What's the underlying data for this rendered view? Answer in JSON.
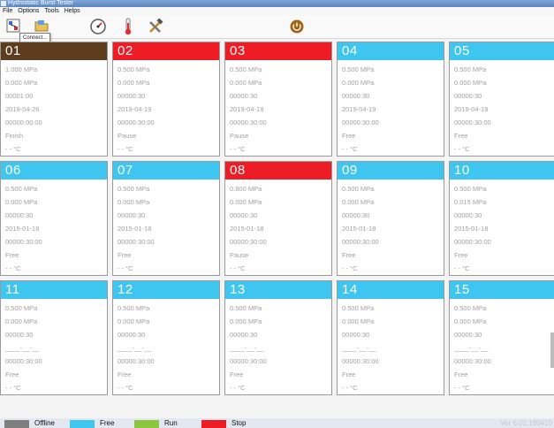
{
  "window": {
    "title": "Hydrostatic Burst Tester"
  },
  "menu": [
    "File",
    "Options",
    "Tools",
    "Helps"
  ],
  "toolbar": {
    "tooltip": "Connect...",
    "icons": [
      "connect-icon",
      "open-folder-icon",
      "pressure-gauge-icon",
      "thermometer-icon",
      "tools-icon",
      "power-icon"
    ]
  },
  "colors": {
    "offline": "#7f7f7f",
    "free": "#3ec6f0",
    "run": "#8cc63f",
    "stop": "#ee1c24",
    "finish": "#5e3c1e"
  },
  "cards": [
    {
      "id": "01",
      "status": "finish",
      "values": [
        "1.000 MPa",
        "0.000 MPa",
        "00001:00",
        "2019-04-26",
        "00000:00:00",
        "Finish",
        "- - °C"
      ]
    },
    {
      "id": "02",
      "status": "stop",
      "values": [
        "0.500 MPa",
        "0.000 MPa",
        "00000:30",
        "2019-04-19",
        "00000:30:00",
        "Pause",
        "- - °C"
      ]
    },
    {
      "id": "03",
      "status": "stop",
      "values": [
        "0.500 MPa",
        "0.000 MPa",
        "00000:30",
        "2019-04-19",
        "00000:30:00",
        "Pause",
        "- - °C"
      ]
    },
    {
      "id": "04",
      "status": "free",
      "values": [
        "0.500 MPa",
        "0.000 MPa",
        "00000:30",
        "2019-04-19",
        "00000:30:00",
        "Free",
        "- - °C"
      ]
    },
    {
      "id": "05",
      "status": "free",
      "values": [
        "0.500 MPa",
        "0.000 MPa",
        "00000:30",
        "2019-04-19",
        "00000:30:00",
        "Free",
        "- - °C"
      ]
    },
    {
      "id": "06",
      "status": "free",
      "values": [
        "0.500 MPa",
        "0.000 MPa",
        "00000:30",
        "2015-01-18",
        "00000:30:00",
        "Free",
        "- - °C"
      ]
    },
    {
      "id": "07",
      "status": "free",
      "values": [
        "0.500 MPa",
        "0.000 MPa",
        "00000:30",
        "2015-01-18",
        "00000:30:00",
        "Free",
        "- - °C"
      ]
    },
    {
      "id": "08",
      "status": "stop",
      "values": [
        "0.800 MPa",
        "0.000 MPa",
        "00000:30",
        "2015-01-18",
        "00000:30:00",
        "Pause",
        "- - °C"
      ]
    },
    {
      "id": "09",
      "status": "free",
      "values": [
        "0.500 MPa",
        "0.000 MPa",
        "00000:30",
        "2015-01-18",
        "00000:30:00",
        "Free",
        "- - °C"
      ]
    },
    {
      "id": "10",
      "status": "free",
      "values": [
        "0.500 MPa",
        "0.015 MPa",
        "00000:30",
        "2015-01-18",
        "00000:30:00",
        "Free",
        "- - °C"
      ]
    },
    {
      "id": "11",
      "status": "free",
      "values": [
        "0.500 MPa",
        "0.000 MPa",
        "00000:30",
        "____-__-__",
        "00000:30:00",
        "Free",
        "- - °C"
      ]
    },
    {
      "id": "12",
      "status": "free",
      "values": [
        "0.500 MPa",
        "0.000 MPa",
        "00000:30",
        "____-__-__",
        "00000:30:00",
        "Free",
        "- - °C"
      ]
    },
    {
      "id": "13",
      "status": "free",
      "values": [
        "0.500 MPa",
        "0.000 MPa",
        "00000:30",
        "____-__-__",
        "00000:30:00",
        "Free",
        "- - °C"
      ]
    },
    {
      "id": "14",
      "status": "free",
      "values": [
        "0.500 MPa",
        "0.000 MPa",
        "00000:30",
        "____-__-__",
        "00000:30:00",
        "Free",
        "- - °C"
      ]
    },
    {
      "id": "15",
      "status": "free",
      "values": [
        "0.500 MPa",
        "0.000 MPa",
        "00000:30",
        "____-__-__",
        "00000:30:00",
        "Free",
        "- - °C"
      ]
    }
  ],
  "legend": [
    {
      "label": "Offline",
      "status": "offline"
    },
    {
      "label": "Free",
      "status": "free"
    },
    {
      "label": "Run",
      "status": "run"
    },
    {
      "label": "Stop",
      "status": "stop"
    }
  ],
  "version": "Ver 6.01.190410"
}
